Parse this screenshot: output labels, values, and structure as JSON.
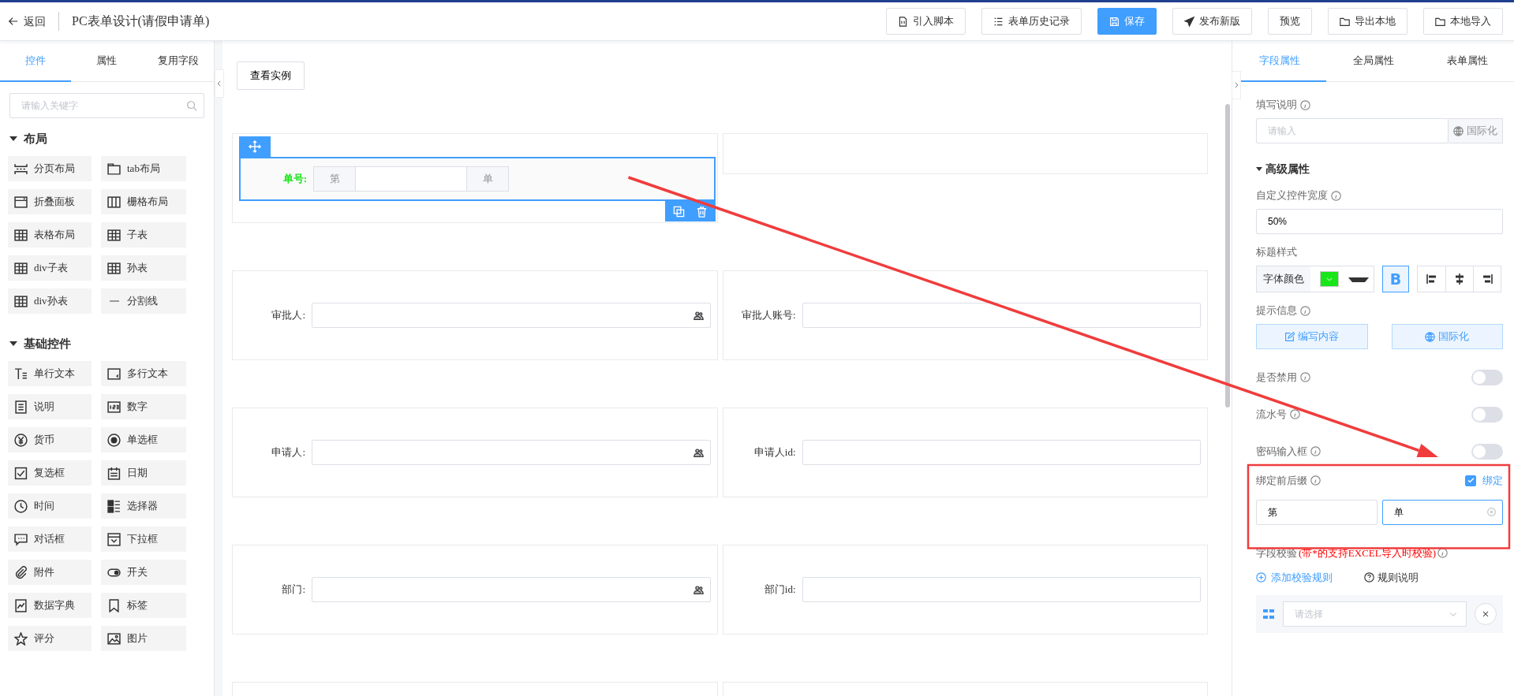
{
  "header": {
    "back": "返回",
    "title": "PC表单设计(请假申请单)",
    "actions": [
      {
        "label": "引入脚本",
        "kind": "default"
      },
      {
        "label": "表单历史记录",
        "kind": "default"
      },
      {
        "label": "保存",
        "kind": "primary"
      },
      {
        "label": "发布新版",
        "kind": "default"
      },
      {
        "label": "预览",
        "kind": "default"
      },
      {
        "label": "导出本地",
        "kind": "default"
      },
      {
        "label": "本地导入",
        "kind": "default"
      }
    ]
  },
  "left_panel": {
    "tabs": [
      {
        "label": "控件",
        "selected": true
      },
      {
        "label": "属性",
        "selected": false
      },
      {
        "label": "复用字段",
        "selected": false
      }
    ],
    "search": {
      "placeholder": "请输入关键字"
    },
    "groups": [
      {
        "title": "布局",
        "expanded": true,
        "items": [
          "分页布局",
          "tab布局",
          "折叠面板",
          "栅格布局",
          "表格布局",
          "子表",
          "div子表",
          "孙表",
          "div孙表",
          "分割线"
        ]
      },
      {
        "title": "基础控件",
        "expanded": true,
        "items": [
          "单行文本",
          "多行文本",
          "说明",
          "数字",
          "货币",
          "单选框",
          "复选框",
          "日期",
          "时间",
          "选择器",
          "对话框",
          "下拉框",
          "附件",
          "开关",
          "数据字典",
          "标签",
          "评分",
          "图片"
        ]
      }
    ]
  },
  "form": {
    "example_button": "查看实例",
    "rows": [
      {
        "cells": [
          {
            "kind": "affix",
            "label": "单号:",
            "prefix": "第",
            "suffix": "单",
            "selected": true
          },
          {
            "kind": "empty",
            "selected": false
          }
        ]
      },
      {
        "cells": [
          {
            "kind": "user",
            "label": "审批人:",
            "selected": false
          },
          {
            "kind": "text",
            "label": "审批人账号:",
            "selected": false
          }
        ]
      },
      {
        "cells": [
          {
            "kind": "user",
            "label": "申请人:",
            "selected": false
          },
          {
            "kind": "text",
            "label": "申请人id:",
            "selected": false
          }
        ]
      },
      {
        "cells": [
          {
            "kind": "user",
            "label": "部门:",
            "selected": false
          },
          {
            "kind": "text",
            "label": "部门id:",
            "selected": false
          }
        ]
      },
      {
        "cells": [
          {
            "kind": "empty",
            "selected": false
          },
          {
            "kind": "empty",
            "selected": false
          }
        ]
      }
    ]
  },
  "right_panel": {
    "tabs": [
      {
        "label": "字段属性",
        "selected": true
      },
      {
        "label": "全局属性",
        "selected": false
      },
      {
        "label": "表单属性",
        "selected": false
      }
    ],
    "fill_hint": {
      "label": "填写说明",
      "placeholder": "请输入",
      "i18n": "国际化"
    },
    "advanced": {
      "title": "高级属性",
      "expanded": true
    },
    "width": {
      "label": "自定义控件宽度",
      "value": "50%"
    },
    "title_style": {
      "label": "标题样式",
      "color_label": "字体颜色",
      "color": "#19e619",
      "bold_label": "B",
      "bold": true
    },
    "tip": {
      "label": "提示信息",
      "edit": "编写内容",
      "i18n": "国际化"
    },
    "toggles": [
      {
        "label": "是否禁用",
        "on": false
      },
      {
        "label": "流水号",
        "on": false
      },
      {
        "label": "密码输入框",
        "on": false
      }
    ],
    "affix": {
      "label": "绑定前后缀",
      "checkbox_label": "绑定",
      "checked": true,
      "prefix": "第",
      "suffix": "单"
    },
    "validation": {
      "label": "字段校验",
      "note": "(带*的支持EXCEL导入时校验)",
      "add": "添加校验规则",
      "help": "规则说明",
      "rules": [
        {
          "placeholder": "请选择"
        }
      ]
    }
  }
}
